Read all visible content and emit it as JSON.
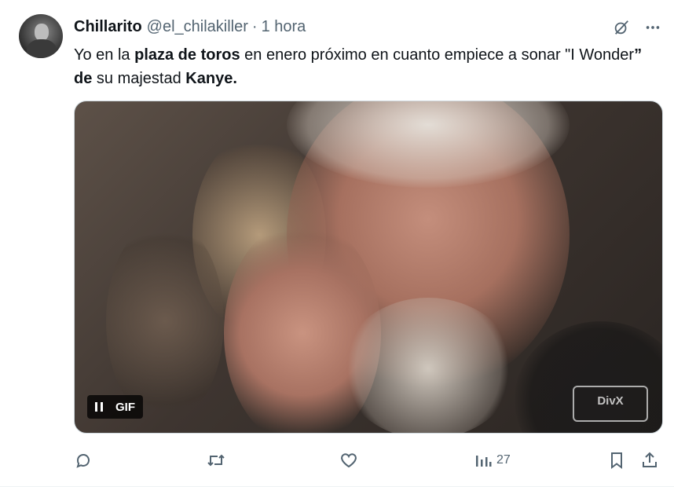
{
  "tweet": {
    "author_name": "Chillarito",
    "handle": "@el_chilakiller",
    "separator": "·",
    "time": "1 hora",
    "text_parts": [
      {
        "text": "Yo en la ",
        "bold": false
      },
      {
        "text": "plaza de toros",
        "bold": true
      },
      {
        "text": " en enero próximo en cuanto empiece a sonar \"I Wonder",
        "bold": false
      },
      {
        "text": "” de",
        "bold": true
      },
      {
        "text": " su majestad ",
        "bold": false
      },
      {
        "text": "Kanye.",
        "bold": true
      }
    ]
  },
  "media": {
    "gif_label": "GIF",
    "watermark": "DivX"
  },
  "actions": {
    "views_count": "27"
  },
  "icons": {
    "grok": "grok-icon",
    "more": "more-icon",
    "reply": "reply-icon",
    "retweet": "retweet-icon",
    "like": "like-icon",
    "views": "views-icon",
    "bookmark": "bookmark-icon",
    "share": "share-icon",
    "pause": "pause-icon"
  },
  "colors": {
    "text": "#0f1419",
    "secondary": "#536471",
    "border": "#cfd9de"
  }
}
